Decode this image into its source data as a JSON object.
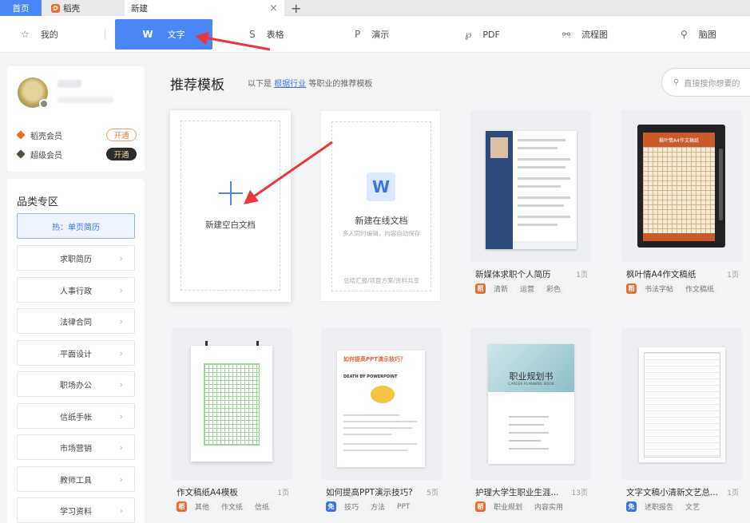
{
  "tabs": {
    "home": "首页",
    "daoke": "稻壳",
    "new": "新建",
    "close": "×",
    "add": "+"
  },
  "typebar": {
    "mine": "我的",
    "word": "文字",
    "table": "表格",
    "ppt": "演示",
    "pdf": "PDF",
    "flow": "流程图",
    "mind": "脑图"
  },
  "membership": {
    "daoke_member": "稻壳会员",
    "daoke_btn": "开通",
    "super_member": "超级会员",
    "super_btn": "开通"
  },
  "categories": {
    "title": "品类专区",
    "hot": "热：单页简历",
    "items": [
      "求职简历",
      "人事行政",
      "法律合同",
      "平面设计",
      "职场办公",
      "信纸手帐",
      "市场营销",
      "教师工具",
      "学习资料"
    ]
  },
  "main": {
    "title": "推荐模板",
    "sub_prefix": "以下是",
    "sub_link": "根据行业",
    "sub_suffix": "等职业的推荐模板",
    "search_placeholder": "直接搜你想要的"
  },
  "blank_card": {
    "label": "新建空白文档"
  },
  "online_card": {
    "label": "新建在线文档",
    "sub": "多人同时编辑，内容自动保存",
    "foot": "总结汇报/项目方案/资料共享",
    "logo": "W"
  },
  "templates": [
    {
      "name": "新媒体求职个人简历",
      "pages": "1页",
      "badge": "稻",
      "tags": [
        "清新",
        "运营",
        "彩色"
      ]
    },
    {
      "name": "枫叶情A4作文稿纸",
      "pages": "1页",
      "badge": "稻",
      "tags": [
        "书法字帖",
        "作文稿纸"
      ],
      "thumb_title": "枫叶情A4作文稿纸"
    },
    {
      "name": "作文稿纸A4模板",
      "pages": "1页",
      "badge": "稻",
      "tags": [
        "其他",
        "作文纸",
        "信纸"
      ]
    },
    {
      "name": "如何提高PPT演示技巧?",
      "pages": "5页",
      "badge": "免",
      "tags": [
        "技巧",
        "方法",
        "PPT"
      ],
      "thumb_title": "如何提高PPT演示技巧？",
      "thumb_sub": "DEATH BY POWERPOINT"
    },
    {
      "name": "护理大学生职业生涯...",
      "pages": "13页",
      "badge": "稻",
      "tags": [
        "职业规划",
        "内容实用"
      ],
      "thumb_title": "职业规划书",
      "thumb_sub": "CAREER PLANNING BOOK"
    },
    {
      "name": "文字文稿小清新文艺总...",
      "pages": "1页",
      "badge": "免",
      "tags": [
        "述职报告",
        "文艺"
      ]
    }
  ],
  "colors": {
    "accent": "#4a86f5",
    "arrow": "#e8383d",
    "orange_badge": "#f26a2b",
    "blue_badge": "#3a76e8"
  }
}
